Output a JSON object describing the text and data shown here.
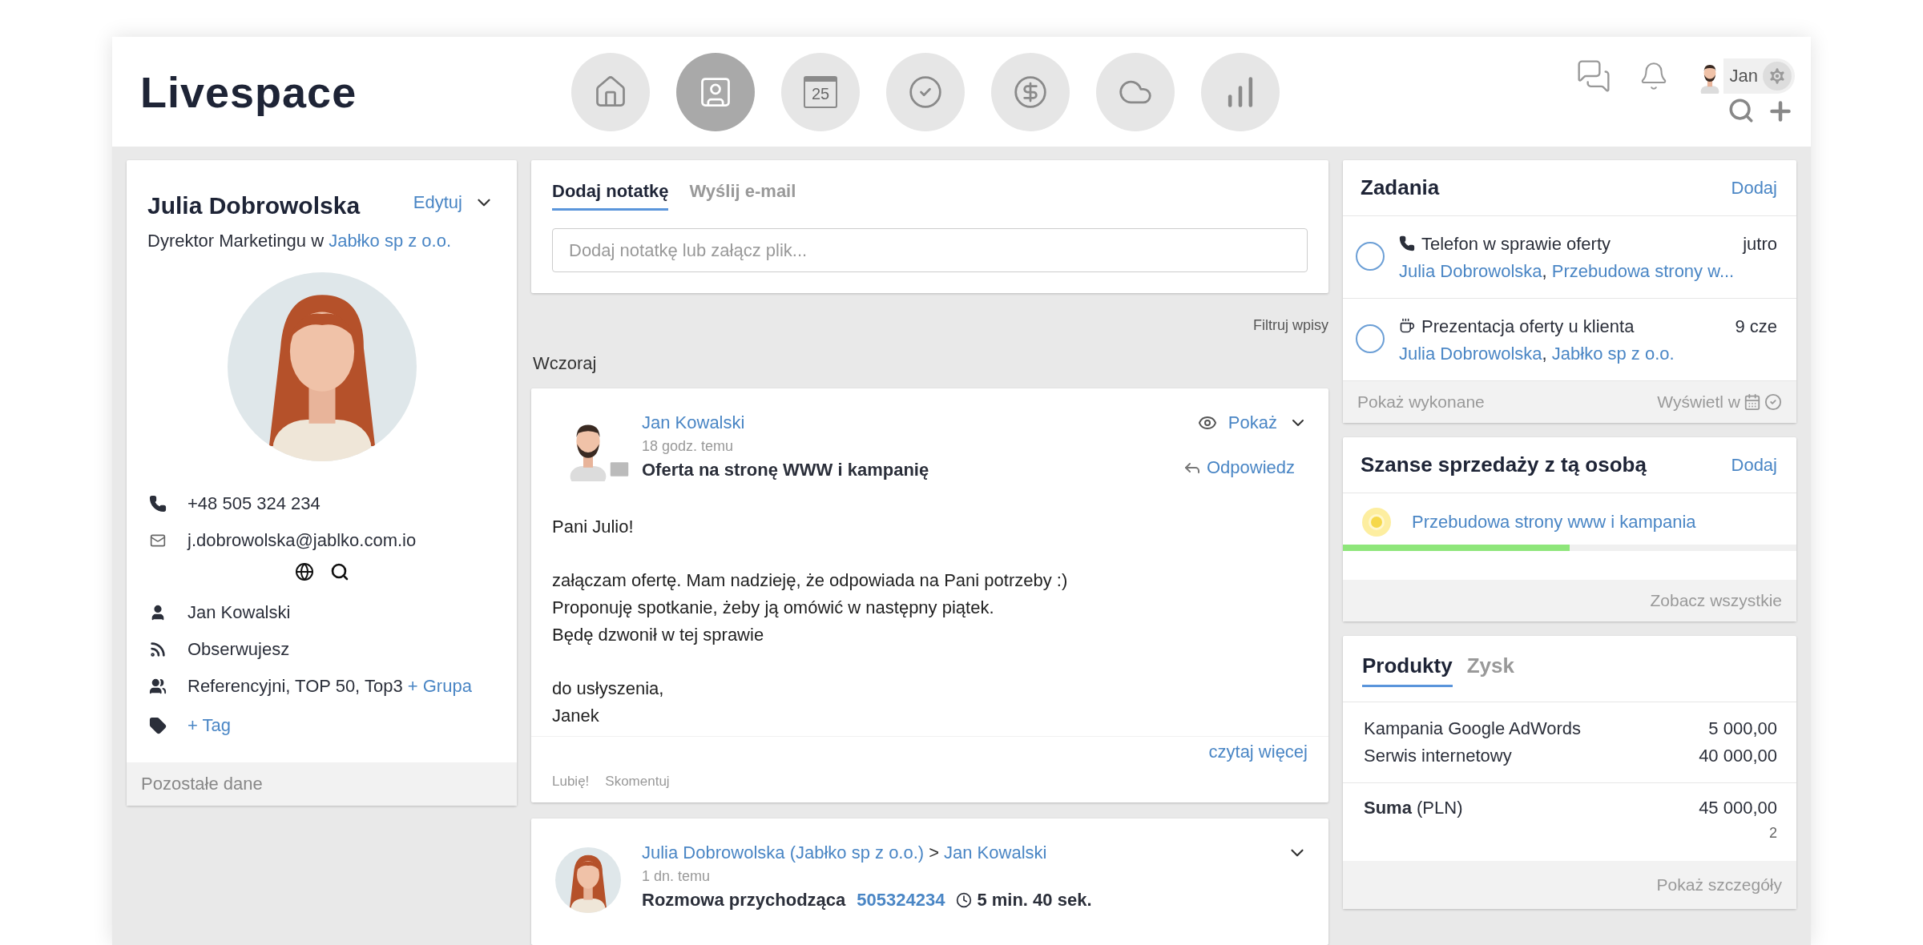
{
  "header": {
    "logo": "Livespace",
    "nav": [
      {
        "kind": "home",
        "selected": false
      },
      {
        "kind": "contacts",
        "selected": true
      },
      {
        "kind": "calendar",
        "selected": false,
        "label": "25"
      },
      {
        "kind": "tasks",
        "selected": false
      },
      {
        "kind": "deals",
        "selected": false
      },
      {
        "kind": "cloud",
        "selected": false
      },
      {
        "kind": "reports",
        "selected": false
      }
    ],
    "user": {
      "name": "Jan",
      "avatar": {
        "kind": "picture"
      }
    }
  },
  "contact": {
    "name": "Julia Dobrowolska",
    "edit": "Edytuj",
    "position": "Dyrektor Marketingu w",
    "company": "Jabłko sp z o.o.",
    "photo": {
      "kind": "picture"
    },
    "phone": "+48 505 324 234",
    "email": "j.dobrowolska@jablko.com.io",
    "details": [
      {
        "kind": "owner",
        "text": "Jan Kowalski"
      },
      {
        "kind": "follow",
        "text": "Obserwujesz"
      },
      {
        "kind": "groups",
        "text": "Referencyjni, TOP 50, Top3",
        "link": "+ Grupa"
      },
      {
        "kind": "tag",
        "link": "+ Tag"
      }
    ],
    "footer": "Pozostałe dane"
  },
  "composer": {
    "tabs": [
      {
        "label": "Dodaj notatkę",
        "selected": true
      },
      {
        "label": "Wyślij e-mail",
        "selected": false
      }
    ],
    "placeholder": "Dodaj notatkę lub załącz plik..."
  },
  "feed": {
    "filter": "Filtruj wpisy",
    "day": "Wczoraj",
    "entries": [
      {
        "kind": "email",
        "author": "Jan Kowalski",
        "time": "18 godz. temu",
        "subject": "Oferta na stronę WWW i kampanię",
        "show": "Pokaż",
        "reply": "Odpowiedz",
        "paragraphs": [
          [
            "Pani Julio!"
          ],
          [
            "załączam ofertę. Mam nadzieję, że odpowiada na Pani potrzeby :)",
            "Proponuję spotkanie, żeby ją omówić w następny piątek.",
            "Będę dzwonił w tej sprawie"
          ],
          [
            "do usłyszenia,",
            "Janek"
          ]
        ],
        "read_more": "czytaj więcej",
        "actions": [
          "Lubię!",
          "Skomentuj"
        ],
        "avatar": {
          "kind": "picture"
        }
      },
      {
        "kind": "call",
        "author": "Julia Dobrowolska (Jabłko sp z o.o.)",
        "separator": ">",
        "recipient": "Jan Kowalski",
        "time": "1 dn. temu",
        "subject": "Rozmowa przychodząca",
        "number": "505324234",
        "duration": "5 min. 40 sek.",
        "avatar": {
          "kind": "picture"
        }
      }
    ]
  },
  "tasks": {
    "title": "Zadania",
    "add": "Dodaj",
    "items": [
      {
        "kind": "call",
        "title": "Telefon w sprawie oferty",
        "due": "jutro",
        "done": false,
        "links": [
          "Julia Dobrowolska",
          "Przebudowa strony w..."
        ]
      },
      {
        "kind": "meeting",
        "title": "Prezentacja oferty u klienta",
        "due": "9 cze",
        "done": false,
        "links": [
          "Julia Dobrowolska",
          "Jabłko sp z o.o."
        ]
      }
    ],
    "link_separator": ",",
    "show_done": "Pokaż wykonane",
    "view_in": "Wyświetl w"
  },
  "deals": {
    "title": "Szanse sprzedaży z tą osobą",
    "add": "Dodaj",
    "items": [
      {
        "name": "Przebudowa strony www i kampania",
        "level": 0.5
      }
    ],
    "footer": "Zobacz wszystkie"
  },
  "products": {
    "tabs": [
      {
        "label": "Produkty",
        "selected": true
      },
      {
        "label": "Zysk",
        "selected": false
      }
    ],
    "items": [
      {
        "name": "Kampania Google AdWords",
        "amount": "5 000,00"
      },
      {
        "name": "Serwis internetowy",
        "amount": "40 000,00"
      }
    ],
    "total": {
      "label": "Suma",
      "currency": "(PLN)",
      "amount": "45 000,00",
      "count": "2"
    },
    "footer": "Pokaż szczegóły"
  }
}
